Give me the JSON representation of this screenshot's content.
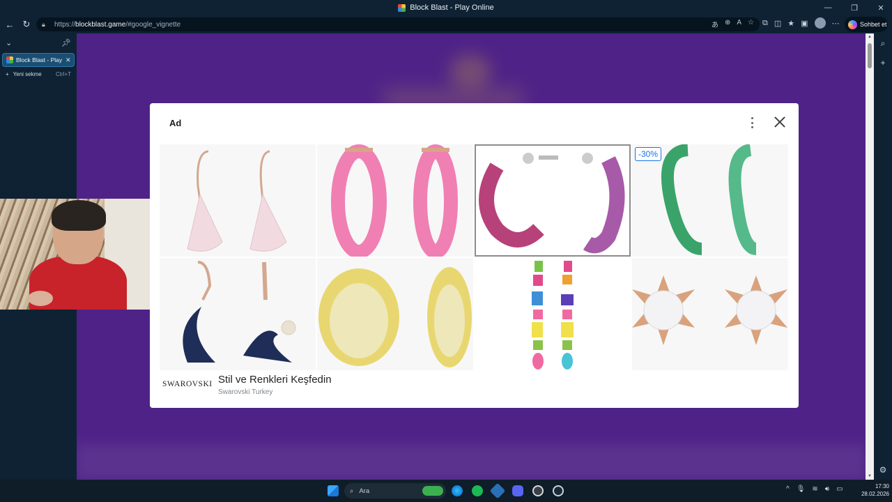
{
  "window": {
    "title": "Block Blast - Play Online"
  },
  "addressbar": {
    "url_prefix": "https://",
    "url_host": "blockblast.game",
    "url_path": "/#google_vignette"
  },
  "toolbar": {
    "copilot_label": "Sohbet et"
  },
  "sidebar": {
    "tabs": [
      {
        "label": "Block Blast - Play O"
      }
    ],
    "new_tab_label": "Yeni sekme",
    "new_tab_shortcut": "Ctrl+T"
  },
  "ad": {
    "label": "Ad",
    "discount_badge": "-30%",
    "brand": "SWAROVSKI",
    "headline": "Stil ve Renkleri Keşfedin",
    "advertiser": "Swarovski Turkey",
    "products": [
      {
        "name": "clear-drop-earrings",
        "color": "#f3d6dc"
      },
      {
        "name": "pink-hoop-earrings",
        "color": "#f07fb3"
      },
      {
        "name": "purple-gem-hoop-earrings",
        "color": "#b7427a"
      },
      {
        "name": "green-hoop-earrings",
        "color": "#3aa36a"
      },
      {
        "name": "moon-drop-earrings",
        "color": "#1f2e58"
      },
      {
        "name": "gold-pave-hoop-earrings",
        "color": "#e8d770"
      },
      {
        "name": "multicolor-drop-earrings",
        "color": "#e24a8c"
      },
      {
        "name": "star-flower-earrings",
        "color": "#d9a27d"
      }
    ]
  },
  "taskbar": {
    "search_placeholder": "Ara",
    "time": "17:30",
    "date": "28.02.2026"
  }
}
